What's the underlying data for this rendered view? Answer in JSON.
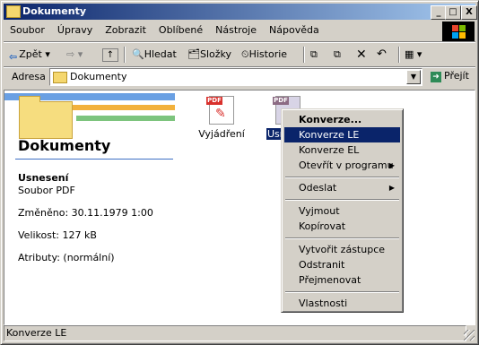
{
  "window": {
    "title": "Dokumenty",
    "minimize_glyph": "_",
    "maximize_glyph": "□",
    "close_glyph": "X"
  },
  "menu": [
    "Soubor",
    "Úpravy",
    "Zobrazit",
    "Oblíbené",
    "Nástroje",
    "Nápověda"
  ],
  "toolbar": {
    "back": "Zpět",
    "back_icon": "back-arrow-icon",
    "forward_icon": "forward-arrow-icon",
    "up_icon": "folder-up-icon",
    "search": "Hledat",
    "folders": "Složky",
    "history": "Historie"
  },
  "address": {
    "label": "Adresa",
    "value": "Dokumenty",
    "go": "Přejít"
  },
  "panel": {
    "title": "Dokumenty",
    "selected_name": "Usnesení",
    "selected_type": "Soubor PDF",
    "modified": "Změněno: 30.11.1979 1:00",
    "size": "Velikost: 127 kB",
    "attributes": "Atributy: (normální)"
  },
  "files": [
    {
      "label": "Vyjádření",
      "tag": "PDF",
      "icon": "pdf-file-icon"
    },
    {
      "label": "Usn",
      "tag": "PDF",
      "icon": "pdf-file-icon"
    }
  ],
  "context_menu": [
    {
      "label": "Konverze...",
      "bold": true
    },
    {
      "label": "Konverze LE",
      "selected": true
    },
    {
      "label": "Konverze EL"
    },
    {
      "label": "Otevřít v programu",
      "submenu": true
    },
    {
      "separator": true
    },
    {
      "label": "Odeslat",
      "submenu": true
    },
    {
      "separator": true
    },
    {
      "label": "Vyjmout"
    },
    {
      "label": "Kopírovat"
    },
    {
      "separator": true
    },
    {
      "label": "Vytvořit zástupce"
    },
    {
      "label": "Odstranit"
    },
    {
      "label": "Přejmenovat"
    },
    {
      "separator": true
    },
    {
      "label": "Vlastnosti"
    }
  ],
  "status": {
    "text": "Konverze LE"
  },
  "colors": {
    "titlebar": "#0a246a",
    "selection": "#0a246a",
    "window_face": "#d4d0c8"
  }
}
